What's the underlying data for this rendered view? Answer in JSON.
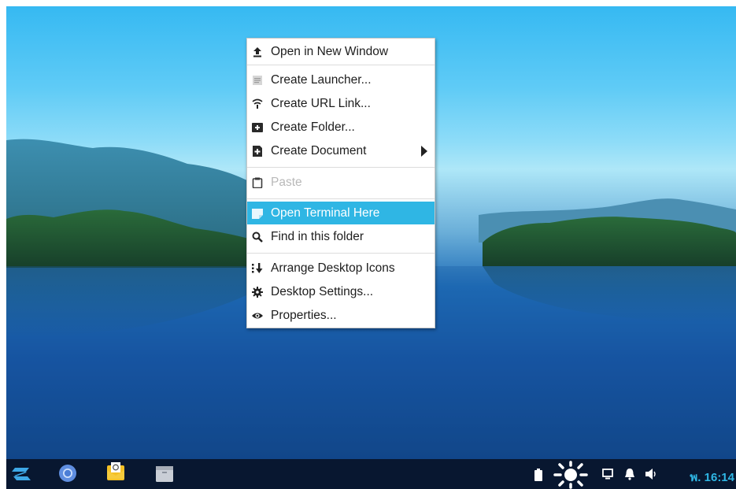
{
  "menu": {
    "items": [
      {
        "label": "Open in New Window",
        "icon": "upload-icon",
        "state": "normal"
      },
      {
        "label": "Create Launcher...",
        "icon": "document-lines-icon",
        "state": "normal"
      },
      {
        "label": "Create URL Link...",
        "icon": "link-icon",
        "state": "normal"
      },
      {
        "label": "Create Folder...",
        "icon": "folder-plus-icon",
        "state": "normal"
      },
      {
        "label": "Create Document",
        "icon": "document-plus-icon",
        "state": "normal",
        "submenu": true
      },
      {
        "label": "Paste",
        "icon": "clipboard-icon",
        "state": "disabled"
      },
      {
        "label": "Open Terminal Here",
        "icon": "terminal-icon",
        "state": "highlighted"
      },
      {
        "label": "Find in this folder",
        "icon": "search-icon",
        "state": "normal"
      },
      {
        "label": "Arrange Desktop Icons",
        "icon": "sort-icon",
        "state": "normal"
      },
      {
        "label": "Desktop Settings...",
        "icon": "gear-icon",
        "state": "normal"
      },
      {
        "label": "Properties...",
        "icon": "eye-icon",
        "state": "normal"
      }
    ]
  },
  "taskbar": {
    "apps": [
      "zorin-menu-icon",
      "chromium-icon",
      "mail-icon",
      "file-manager-icon"
    ],
    "tray": [
      "battery-icon",
      "brightness-icon",
      "display-icon",
      "notification-bell-icon",
      "volume-icon"
    ],
    "clock": "พ. 16:14"
  },
  "colors": {
    "highlight": "#2fb6e4",
    "taskbar": "#081730",
    "clock": "#2fb6e4"
  }
}
